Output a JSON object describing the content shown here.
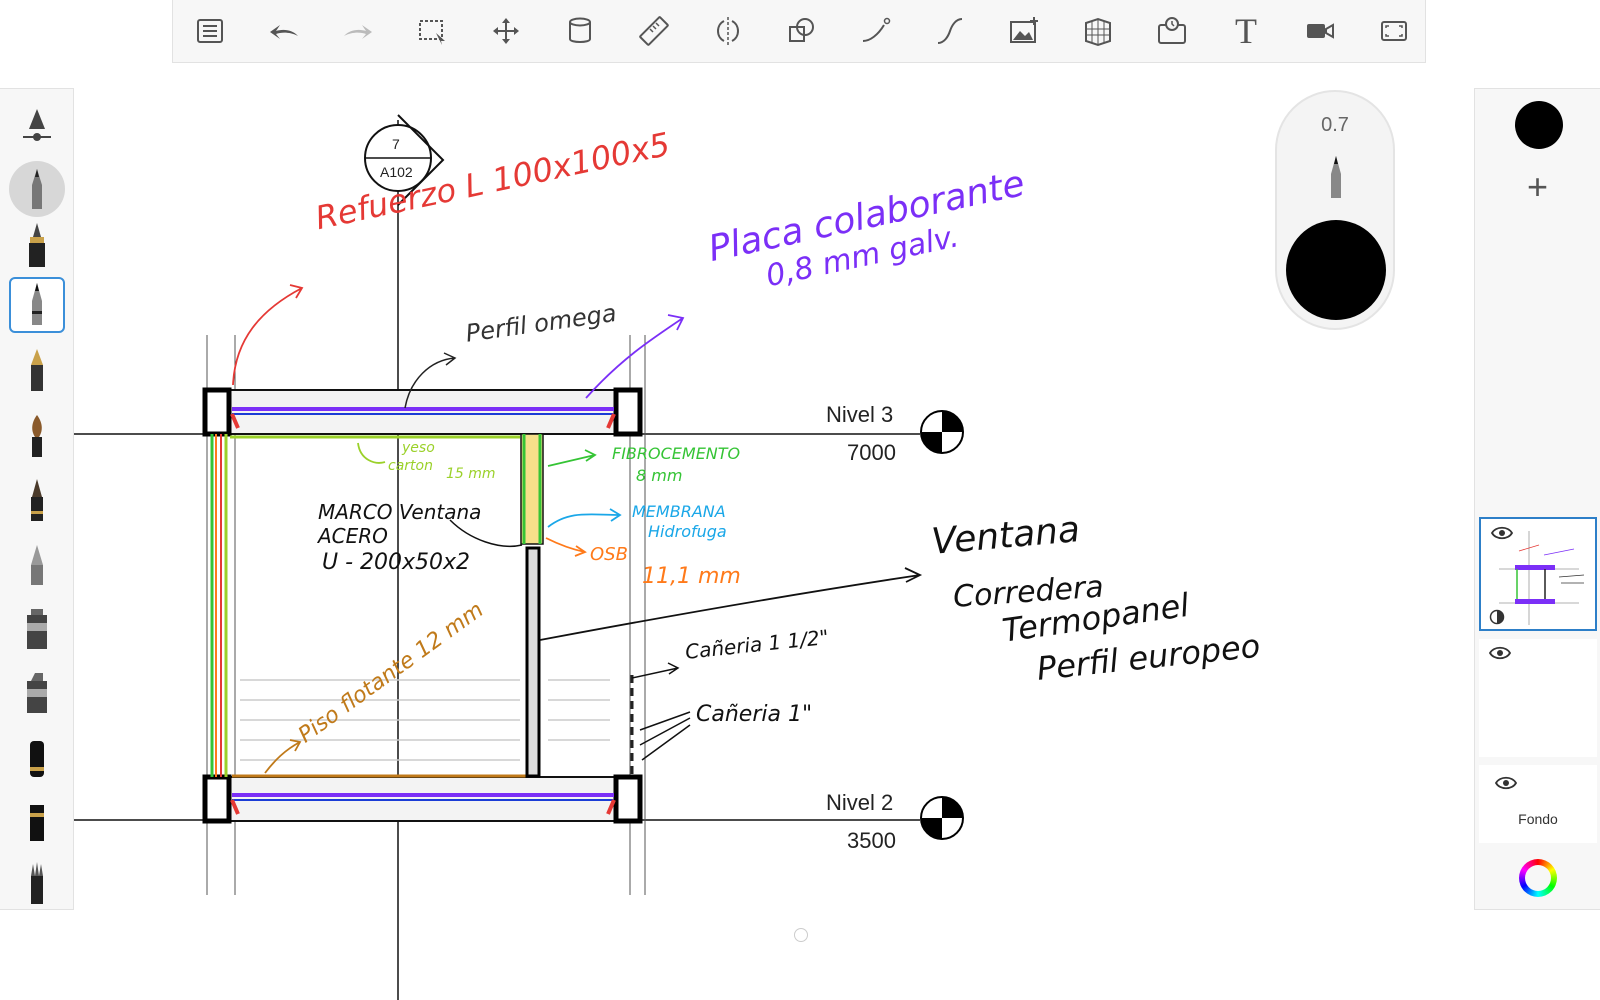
{
  "toolbar": {
    "tools": [
      "list-icon",
      "undo-icon",
      "redo-icon",
      "selection-icon",
      "transform-icon",
      "fill-icon",
      "ruler-icon",
      "symmetry-icon",
      "shape-icon",
      "stroke-icon",
      "curve-icon",
      "add-image-icon",
      "perspective-icon",
      "timelapse-icon",
      "text-icon",
      "video-icon",
      "fullscreen-icon"
    ]
  },
  "brush_panel": {
    "brushes": [
      "size-slider",
      "pencil",
      "inking-pen",
      "technical-pen",
      "fountain-pen",
      "brush",
      "felt-tip",
      "airbrush",
      "marker",
      "chisel-marker",
      "eraser-soft",
      "eraser-hard",
      "smudge"
    ],
    "selected_index": 3
  },
  "opacity": {
    "value": "0.7",
    "size_label": ""
  },
  "layers": {
    "color": "#000000",
    "background_label": "Fondo"
  },
  "drawing": {
    "section_ref": {
      "number": "7",
      "sheet": "A102"
    },
    "levels": [
      {
        "name": "Nivel 3",
        "elevation": "7000"
      },
      {
        "name": "Nivel 2",
        "elevation": "3500"
      }
    ],
    "annotations": {
      "refuerzo": "Refuerzo L 100x100x5",
      "placa_1": "Placa colaborante",
      "placa_2": "0,8 mm galv.",
      "perfil_omega": "Perfil omega",
      "yeso_1": "yeso",
      "yeso_2": "carton",
      "yeso_3": "15 mm",
      "fibro_1": "FIBROCEMENTO",
      "fibro_2": "8 mm",
      "membrana_1": "MEMBRANA",
      "membrana_2": "Hidrofuga",
      "osb": "OSB",
      "osb_mm": "11,1 mm",
      "marco_1": "MARCO Ventana",
      "marco_2": "ACERO",
      "marco_3": "U - 200x50x2",
      "ventana_1": "Ventana",
      "ventana_2": "Corredera",
      "ventana_3": "Termopanel",
      "ventana_4": "Perfil europeo",
      "piso": "Piso flotante 12 mm",
      "caneria_1": "Cañeria 1 1/2\"",
      "caneria_2": "Cañeria 1\""
    },
    "colors": {
      "red": "#e53935",
      "purple": "#7b2ff7",
      "lime": "#9bd12a",
      "green": "#35c435",
      "cyan": "#1aa7e8",
      "orange": "#ff7a1a",
      "brown": "#c07a1a"
    }
  }
}
